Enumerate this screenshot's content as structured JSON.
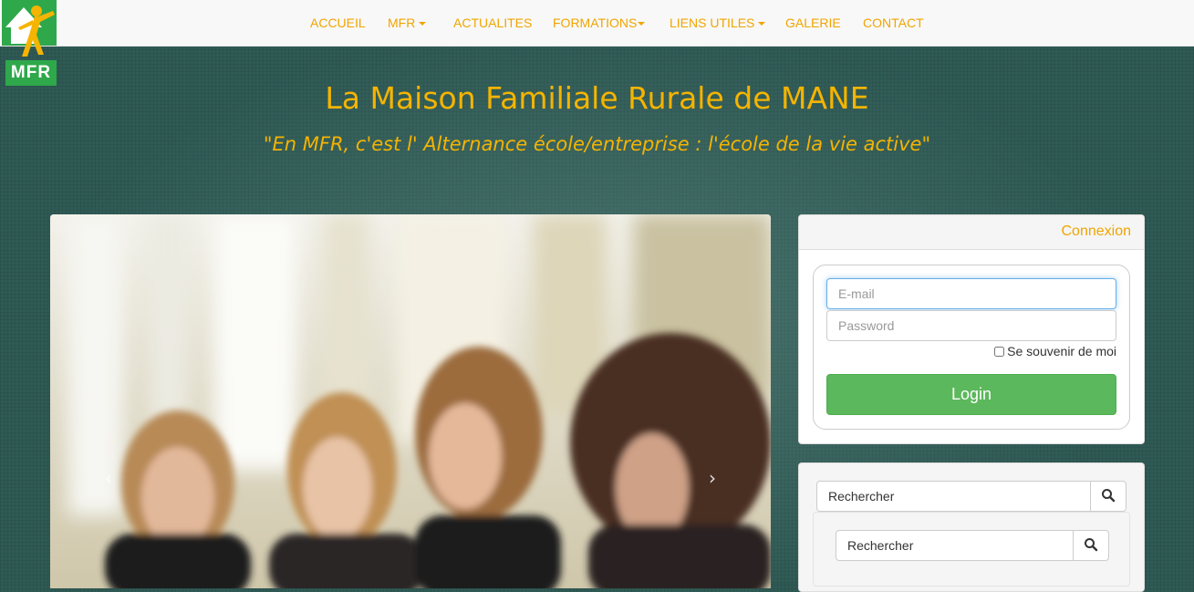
{
  "logo": {
    "text": "MFR",
    "icon": "house-person-logo"
  },
  "nav": {
    "items": [
      {
        "label": "ACCUEIL",
        "dropdown": false
      },
      {
        "label": "MFR",
        "dropdown": true
      },
      {
        "label": "ACTUALITES",
        "dropdown": false
      },
      {
        "label": "FORMATIONS",
        "dropdown": true
      },
      {
        "label": "LIENS UTILES",
        "dropdown": true
      },
      {
        "label": "GALERIE",
        "dropdown": false
      },
      {
        "label": "CONTACT",
        "dropdown": false
      }
    ]
  },
  "header": {
    "title": "La Maison Familiale Rurale de MANE",
    "slogan": "\"En MFR, c'est l' Alternance école/entreprise : l'école de la vie active\""
  },
  "carousel": {
    "prev_icon": "‹",
    "next_icon": "›"
  },
  "login": {
    "heading": "Connexion",
    "email_placeholder": "E-mail",
    "password_placeholder": "Password",
    "remember_label": "Se souvenir de moi",
    "button_label": "Login"
  },
  "search": {
    "placeholder_outer": "Rechercher",
    "placeholder_inner": "Rechercher",
    "icon": "search-icon"
  },
  "colors": {
    "accent": "#f0a500",
    "title": "#f5b400",
    "background": "#2f5a55",
    "login_button": "#5cb85c",
    "logo_green": "#2ea84a"
  }
}
